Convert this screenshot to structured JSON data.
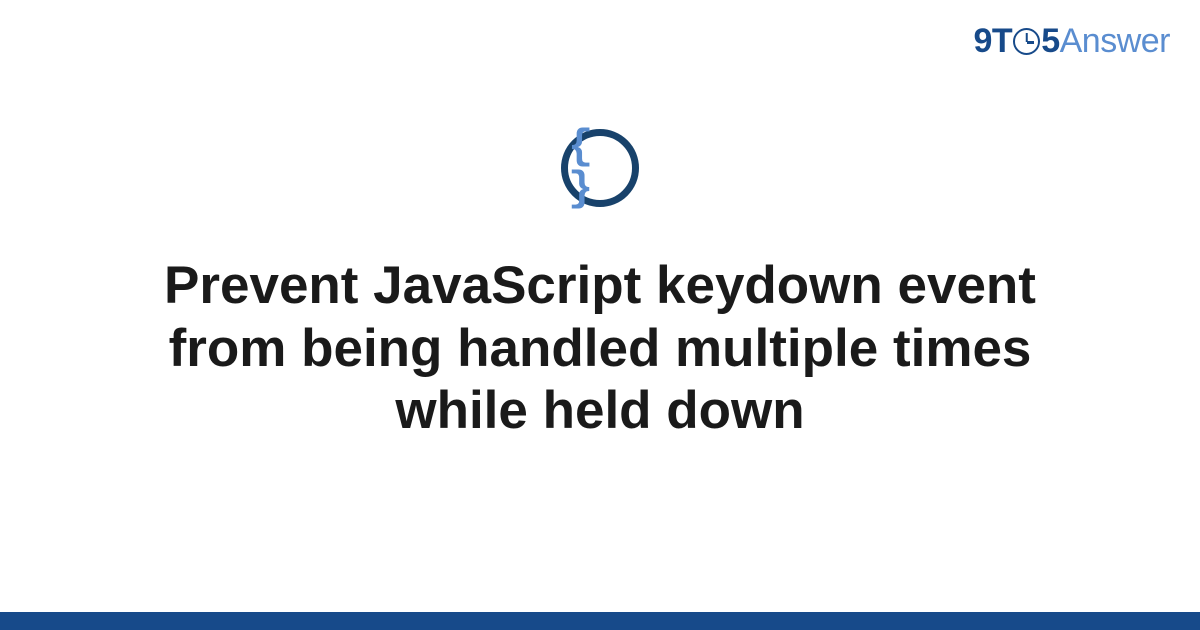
{
  "logo": {
    "part1": "9T",
    "part2": "5",
    "part3": "Answer"
  },
  "topic": {
    "icon_symbol": "{ }",
    "icon_name": "code-braces"
  },
  "title": "Prevent JavaScript keydown event from being handled multiple times while held down",
  "colors": {
    "primary_dark": "#174a8a",
    "primary_light": "#5a8dd0",
    "icon_ring": "#18426b"
  }
}
